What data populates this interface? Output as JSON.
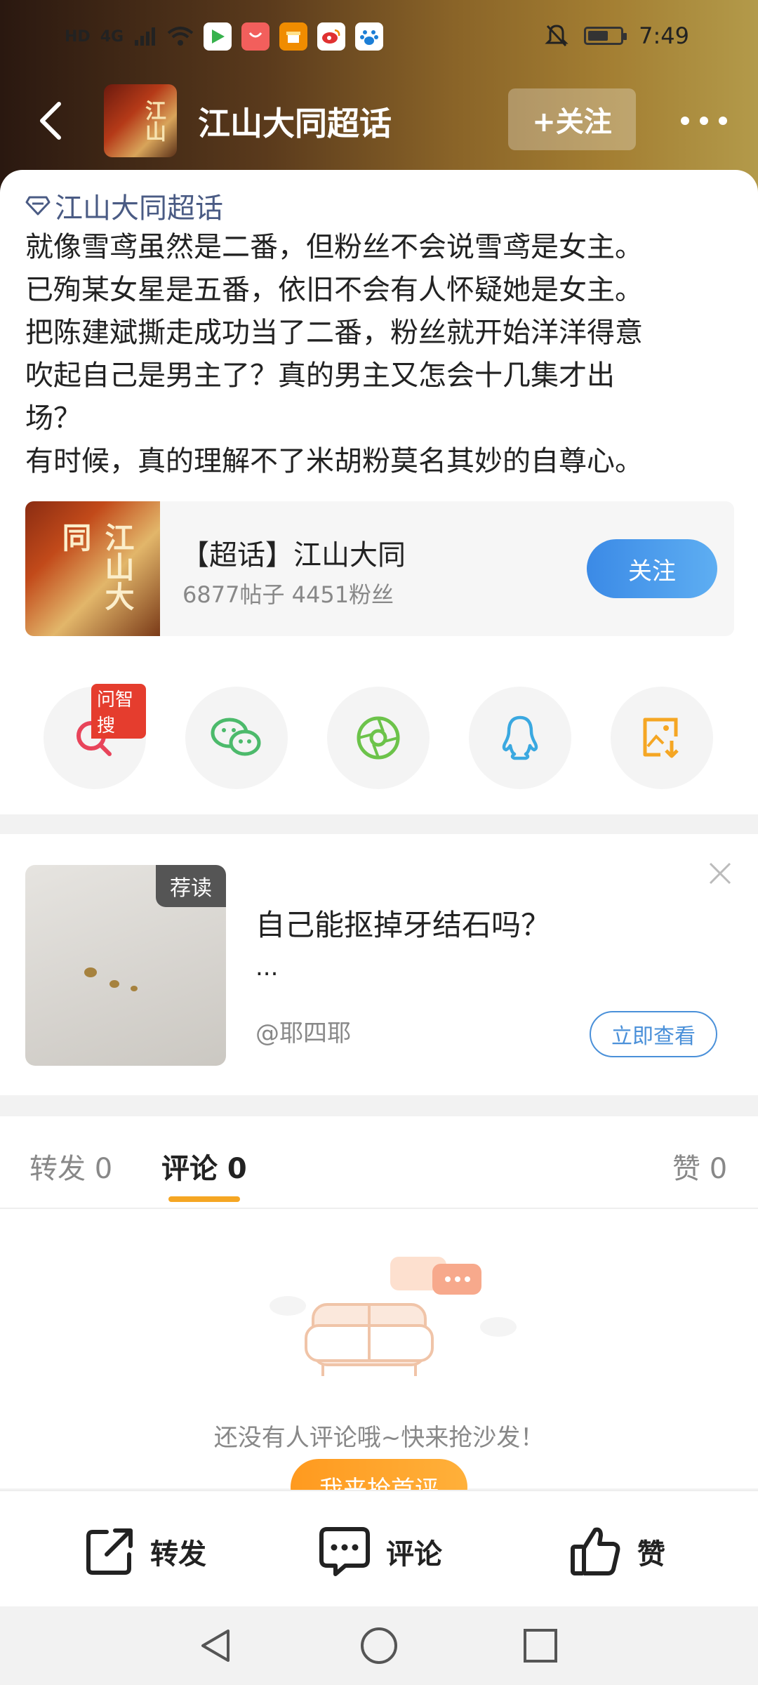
{
  "status_bar": {
    "left_labels": [
      "HD",
      "4G"
    ],
    "time": "7:49",
    "apps": [
      {
        "icon": "video-app-icon",
        "color": "#37b24d"
      },
      {
        "icon": "huawei-app-icon",
        "color": "#f25f5c"
      },
      {
        "icon": "gift-app-icon",
        "color": "#f08c00"
      },
      {
        "icon": "weibo-app-icon",
        "color": "#e03131"
      },
      {
        "icon": "baidu-app-icon",
        "color": "#1c7ed6"
      }
    ]
  },
  "header": {
    "title": "江山大同超话",
    "follow_label": "+关注",
    "cover_glyphs": "江山"
  },
  "post": {
    "topic_tag": "江山大同超话",
    "lines": [
      "就像雪鸢虽然是二番，但粉丝不会说雪鸢是女主。",
      "已殉某女星是五番，依旧不会有人怀疑她是女主。",
      "把陈建斌撕走成功当了二番，粉丝就开始洋洋得意",
      "吹起自己是男主了？真的男主又怎会十几集才出",
      "场？",
      "有时候，真的理解不了米胡粉莫名其妙的自尊心。"
    ]
  },
  "topic_card": {
    "title": "【超话】江山大同",
    "stats": "6877帖子 4451粉丝",
    "follow_label": "关注",
    "cover_glyphs": "江山大同"
  },
  "share": {
    "badge": "问智搜",
    "items": [
      {
        "icon": "ai-search-icon",
        "color": "#e8445a"
      },
      {
        "icon": "wechat-icon",
        "color": "#4cba6b"
      },
      {
        "icon": "moments-icon",
        "color": "#6cc34a"
      },
      {
        "icon": "qq-icon",
        "color": "#3aa8e0"
      },
      {
        "icon": "save-image-icon",
        "color": "#f5a623"
      }
    ]
  },
  "recommend": {
    "badge": "荐读",
    "title": "自己能抠掉牙结石吗？",
    "excerpt": "...",
    "author": "@耶四耶",
    "view_label": "立即查看"
  },
  "tabs": {
    "repost": "转发 0",
    "comments": "评论 0",
    "likes": "赞 0"
  },
  "empty_state": {
    "text": "还没有人评论哦~快来抢沙发！",
    "button": "我来抢首评"
  },
  "actions": {
    "repost": "转发",
    "comment": "评论",
    "like": "赞"
  },
  "colors": {
    "accent_blue": "#4a90d9",
    "accent_orange": "#f5a623",
    "topic_blue": "#4a5b84"
  }
}
